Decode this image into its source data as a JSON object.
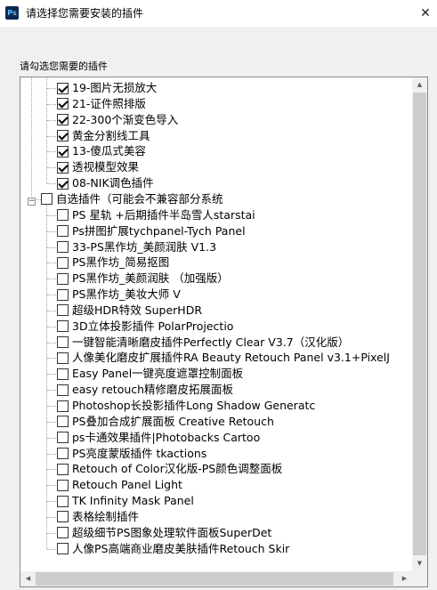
{
  "window": {
    "app_icon": "Ps",
    "title": "请选择您需要安装的插件",
    "close_glyph": "✕"
  },
  "prompt": "请勾选您需要的插件",
  "tree": {
    "checked_group": [
      {
        "label": "19-图片无损放大",
        "checked": true
      },
      {
        "label": "21-证件照排版",
        "checked": true
      },
      {
        "label": "22-300个渐变色导入",
        "checked": true
      },
      {
        "label": "黄金分割线工具",
        "checked": true
      },
      {
        "label": "13-傻瓜式美容",
        "checked": true
      },
      {
        "label": "透视模型效果",
        "checked": true
      },
      {
        "label": "08-NIK调色插件",
        "checked": true
      }
    ],
    "optional_group": {
      "expander_glyph": "−",
      "label": "自选插件（可能会不兼容部分系统",
      "checked": false,
      "items": [
        {
          "label": "PS 星轨 +后期插件半岛雪人starstai",
          "checked": false
        },
        {
          "label": "Ps拼图扩展tychpanel-Tych Panel",
          "checked": false
        },
        {
          "label": "33-PS黑作坊_美颜润肤 V1.3",
          "checked": false
        },
        {
          "label": "PS黑作坊_简易抠图",
          "checked": false
        },
        {
          "label": "PS黑作坊_美颜润肤 （加强版）",
          "checked": false
        },
        {
          "label": "PS黑作坊_美妆大师 V",
          "checked": false
        },
        {
          "label": "超级HDR特效 SuperHDR",
          "checked": false
        },
        {
          "label": "3D立体投影插件 PolarProjectio",
          "checked": false
        },
        {
          "label": "一键智能清晰磨皮插件Perfectly Clear V3.7（汉化版）",
          "checked": false
        },
        {
          "label": "人像美化磨皮扩展插件RA Beauty Retouch Panel v3.1+PixelJ",
          "checked": false
        },
        {
          "label": "Easy Panel一键亮度遮罩控制面板",
          "checked": false
        },
        {
          "label": "easy retouch精修磨皮拓展面板",
          "checked": false
        },
        {
          "label": "Photoshop长投影插件Long Shadow Generatc",
          "checked": false
        },
        {
          "label": "PS叠加合成扩展面板 Creative Retouch",
          "checked": false
        },
        {
          "label": "ps卡通效果插件|Photobacks Cartoo",
          "checked": false
        },
        {
          "label": "PS亮度蒙版插件 tkactions",
          "checked": false
        },
        {
          "label": "Retouch of Color汉化版-PS颜色调整面板",
          "checked": false
        },
        {
          "label": "Retouch Panel Light",
          "checked": false
        },
        {
          "label": "TK Infinity Mask Panel",
          "checked": false
        },
        {
          "label": "表格绘制插件",
          "checked": false
        },
        {
          "label": "超级细节PS图象处理软件面板SuperDet",
          "checked": false
        },
        {
          "label": "人像PS高端商业磨皮美肤插件Retouch Skir",
          "checked": false
        }
      ]
    }
  },
  "scrollbars": {
    "up": "▲",
    "down": "▼",
    "left": "◀",
    "right": "▶"
  }
}
